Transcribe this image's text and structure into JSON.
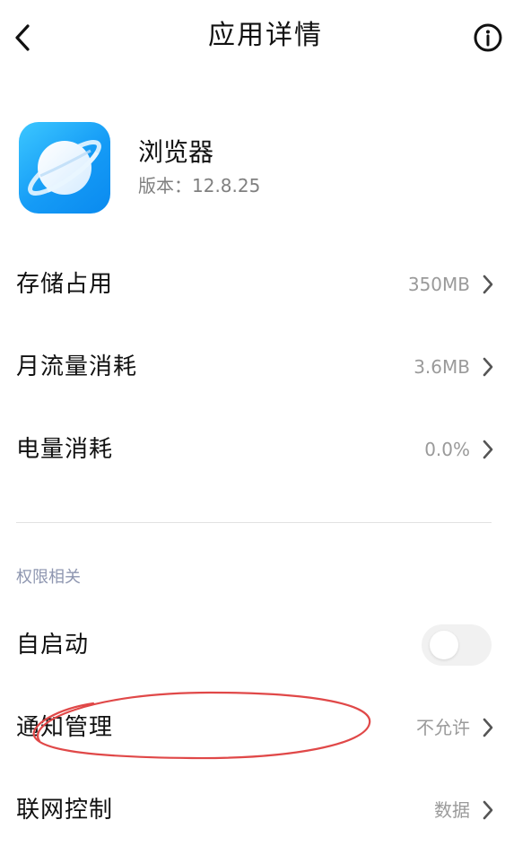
{
  "header": {
    "title": "应用详情",
    "back_icon": "chevron-left-icon",
    "info_icon": "info-icon"
  },
  "app": {
    "name": "浏览器",
    "version": "版本：12.8.25",
    "icon": "planet-icon"
  },
  "usage_rows": [
    {
      "label": "存储占用",
      "value": "350MB"
    },
    {
      "label": "月流量消耗",
      "value": "3.6MB"
    },
    {
      "label": "电量消耗",
      "value": "0.0%"
    }
  ],
  "permissions": {
    "section_title": "权限相关",
    "autostart": {
      "label": "自启动",
      "enabled": false
    },
    "notification": {
      "label": "通知管理",
      "value": "不允许"
    },
    "network": {
      "label": "联网控制",
      "value": "数据"
    }
  },
  "colors": {
    "annotation": "#e04848",
    "app_icon_gradient": [
      "#3cc7ff",
      "#0a8aef"
    ],
    "section_label": "#8e96b0",
    "value_text": "#9a9a9a"
  }
}
